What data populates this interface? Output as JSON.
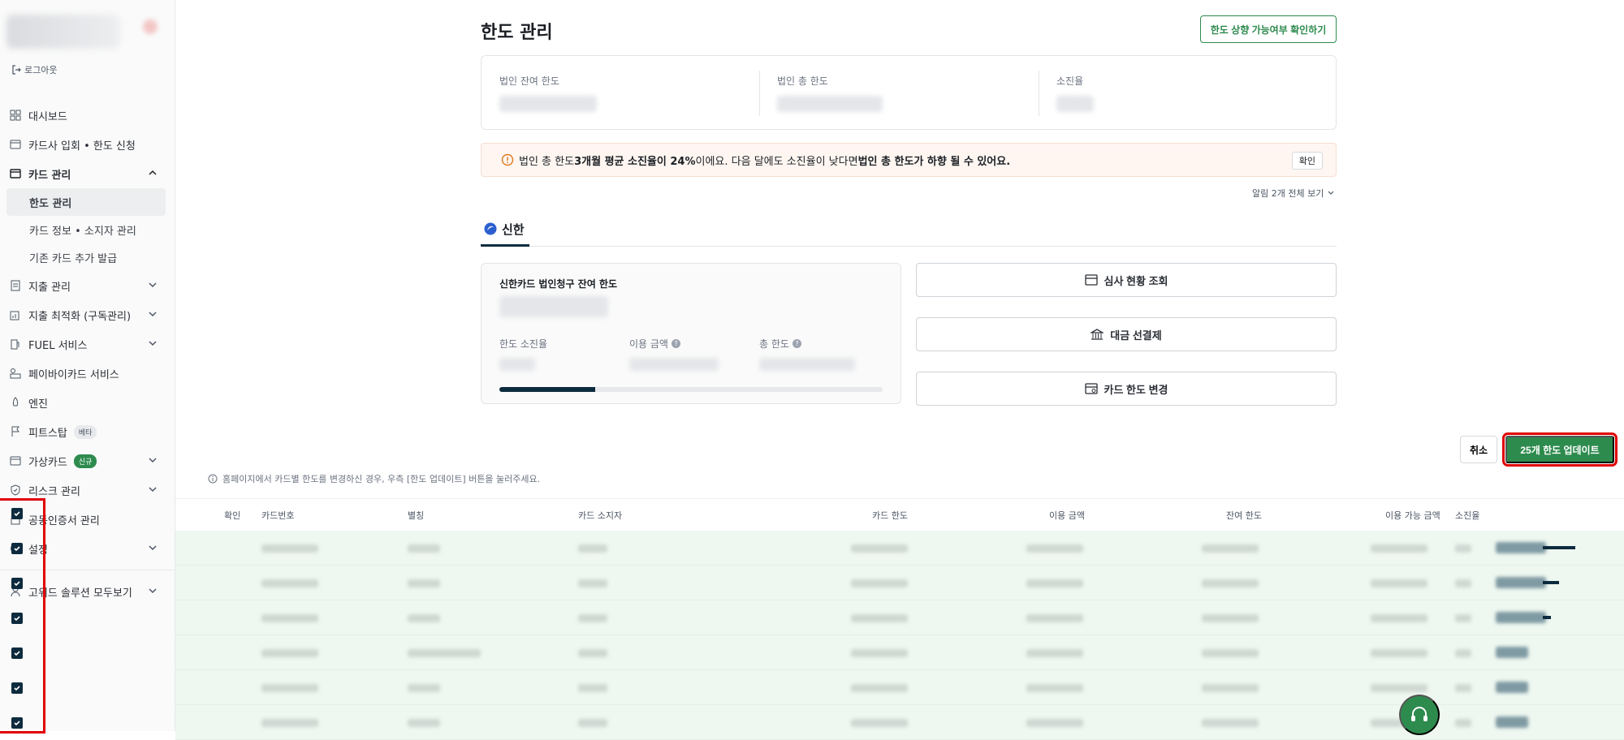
{
  "sidebar": {
    "logout_label": "로그아웃",
    "items": [
      {
        "label": "대시보드"
      },
      {
        "label": "카드사 입회 • 한도 신청"
      },
      {
        "label": "카드 관리"
      },
      {
        "label": "지출 관리"
      },
      {
        "label": "지출 최적화 (구독관리)"
      },
      {
        "label": "FUEL 서비스"
      },
      {
        "label": "페이바이카드 서비스"
      },
      {
        "label": "엔진"
      },
      {
        "label": "피트스탑",
        "tag": "베타"
      },
      {
        "label": "가상카드",
        "tag": "신규"
      },
      {
        "label": "리스크 관리"
      },
      {
        "label": "공동인증서 관리"
      },
      {
        "label": "설정"
      },
      {
        "label": "고위드 솔루션 모두보기"
      }
    ],
    "card_sub": [
      {
        "label": "한도 관리"
      },
      {
        "label": "카드 정보 • 소지자 관리"
      },
      {
        "label": "기존 카드 추가 발급"
      }
    ]
  },
  "header": {
    "title": "한도 관리",
    "check_increase_button": "한도 상향 가능여부 확인하기"
  },
  "summary": {
    "corp_remaining_label": "법인 잔여 한도",
    "corp_total_label": "법인 총 한도",
    "usage_rate_label": "소진율"
  },
  "alert": {
    "text_1": "법인 총 한도 ",
    "bold_1": "3개월 평균 소진율이 24%",
    "text_2": "이에요. 다음 달에도 소진율이 낮다면 ",
    "bold_2": "법인 총 한도가 하향 될 수 있어요.",
    "confirm": "확인",
    "more": "알림 2개 전체 보기"
  },
  "tabs": {
    "shinhan": "신한"
  },
  "card_panel": {
    "title": "신한카드 법인청구 잔여 한도",
    "usage_rate_label": "한도 소진율",
    "used_label": "이용 금액",
    "total_label": "총 한도",
    "progress": 0.25
  },
  "actions": {
    "review_status": "심사 현황 조회",
    "prepay": "대금 선결제",
    "change_limit": "카드 한도 변경"
  },
  "toolbar": {
    "cancel": "취소",
    "update": "25개 한도 업데이트",
    "note": "홈페이지에서 카드별 한도를 변경하신 경우, 우측 [한도 업데이트] 버튼을 눌러주세요."
  },
  "table": {
    "headers": {
      "confirm": "확인",
      "card_number": "카드번호",
      "alias": "별칭",
      "holder": "카드 소지자",
      "card_limit": "카드 한도",
      "used": "이용 금액",
      "remaining": "잔여 한도",
      "available": "이용 가능 금액",
      "usage_rate": "소진율"
    },
    "row_count": 6
  },
  "colors": {
    "brand_green": "#2e8b4e",
    "navy": "#0d2b3e",
    "highlight_red": "#e00000"
  }
}
